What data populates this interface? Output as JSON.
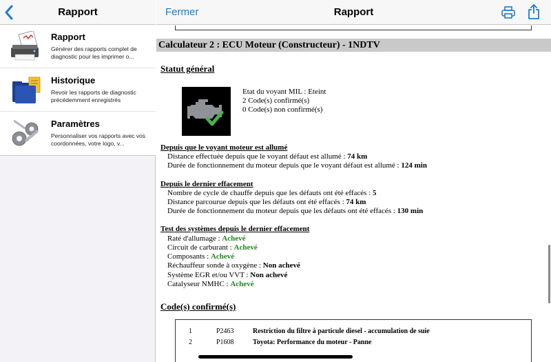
{
  "sidebar": {
    "back_icon": "chevron-left-icon",
    "title": "Rapport",
    "items": [
      {
        "title": "Rapport",
        "description": "Générer des rapports complet de diagnostic pour les imprimer o...",
        "icon": "report-printer-icon"
      },
      {
        "title": "Historique",
        "description": "Revoir les rapports de diagnostic précédemment enregistrés",
        "icon": "folder-history-icon"
      },
      {
        "title": "Paramètres",
        "description": "Personnaliser vos rapports avec vos coordonnées, votre logo, v...",
        "icon": "gears-settings-icon"
      }
    ]
  },
  "main": {
    "close_label": "Fermer",
    "title": "Rapport",
    "print_icon": "printer-icon",
    "share_icon": "share-icon",
    "accent_color": "#1a7bd6"
  },
  "report": {
    "section_title": "Calculateur 2 : ECU Moteur (Constructeur) - 1NDTV",
    "status_title": "Statut général",
    "engine_icon": "engine-check-icon",
    "status_lines": [
      "Etat du voyant MIL : Eteint",
      "2 Code(s) confirmé(s)",
      "0 Code(s) non confirmé(s)"
    ],
    "since_mil": {
      "title": "Depuis que le voyant moteur est allumé",
      "rows": [
        {
          "label": "Distance effectuée depuis que le voyant défaut est allumé : ",
          "value": "74 km"
        },
        {
          "label": "Durée de fonctionnement du moteur depuis que le voyant défaut est allumé : ",
          "value": "124 min"
        }
      ]
    },
    "since_clear": {
      "title": "Depuis le dernier effacement",
      "rows": [
        {
          "label": "Nombre de cycle de chauffe depuis que les défauts ont été effacés : ",
          "value": "5"
        },
        {
          "label": "Distance parcourue depuis que les défauts ont été effacés : ",
          "value": "74 km"
        },
        {
          "label": "Durée de fonctionnement du moteur depuis que les défauts ont été effacés : ",
          "value": "130 min"
        }
      ]
    },
    "tests": {
      "title": "Test des systèmes depuis le dernier effacement",
      "rows": [
        {
          "label": "Raté d'allumage : ",
          "value": "Achevé",
          "status": "ok"
        },
        {
          "label": "Circuit de carburant : ",
          "value": "Achevé",
          "status": "ok"
        },
        {
          "label": "Composants : ",
          "value": "Achevé",
          "status": "ok"
        },
        {
          "label": "Réchauffeur sonde à oxygène : ",
          "value": "Non achevé",
          "status": "nok"
        },
        {
          "label": "Système EGR et/ou VVT : ",
          "value": "Non achevé",
          "status": "nok"
        },
        {
          "label": "Catalyseur NMHC : ",
          "value": "Achevé",
          "status": "ok"
        }
      ],
      "ok_color": "#1a8a1a"
    },
    "codes": {
      "title": "Code(s) confirmé(s)",
      "rows": [
        {
          "num": "1",
          "code": "P2463",
          "desc": "Restriction du filtre à particule diesel - accumulation de suie"
        },
        {
          "num": "2",
          "code": "P1608",
          "desc": "Toyota: Performance du moteur - Panne"
        }
      ]
    }
  }
}
